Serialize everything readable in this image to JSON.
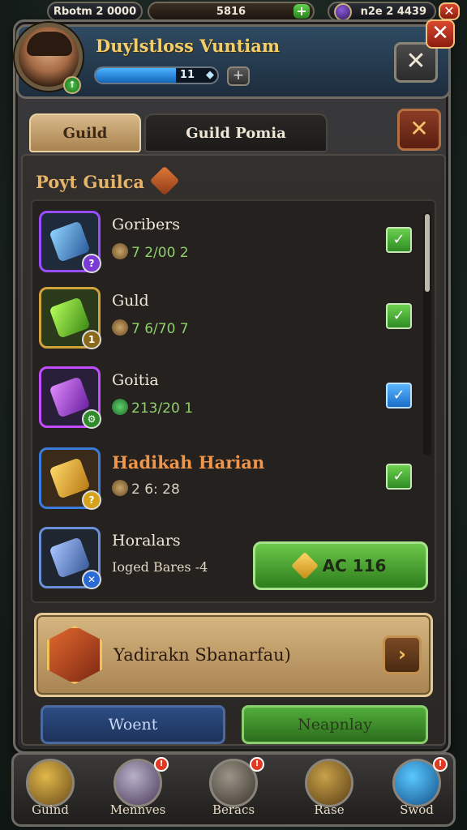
{
  "topbar": {
    "left_currency": "Rbotm 2 0000",
    "mid_currency": "5816",
    "right_currency": "n2e 2 4439"
  },
  "header": {
    "player_name": "Duylstloss Vuntiam",
    "xp_value": "11"
  },
  "tabs": [
    {
      "label": "Guild"
    },
    {
      "label": "Guild Pomia"
    }
  ],
  "section_title": "Poyt Guilca",
  "list": [
    {
      "name": "Goribers",
      "stat": "7 2/00  2",
      "checked": true,
      "check_color": "#4caf3a",
      "accent": "#9a4dff"
    },
    {
      "name": "Guld",
      "stat": "7 6/70  7",
      "checked": true,
      "check_color": "#4caf3a",
      "accent": "#5fd13a"
    },
    {
      "name": "Goitia",
      "stat": "213/20  1",
      "checked": true,
      "check_color": "#3a95e8",
      "accent": "#c14dff"
    },
    {
      "name": "Hadikah Harian",
      "stat": "2 6: 28",
      "checked": true,
      "check_color": "#4caf3a",
      "accent": "#3a7bdc"
    },
    {
      "name": "Horalars",
      "desc": "Ioged Bares -4",
      "accent": "#6b8fd6"
    }
  ],
  "action_button": "AC 116",
  "banner_text": "Yadirakn Sbanarfau)",
  "buttons": {
    "blue": "Woent",
    "green": "Neapnlay"
  },
  "bottom_nav": [
    {
      "label": "Guind"
    },
    {
      "label": "Mennves"
    },
    {
      "label": "Beracs"
    },
    {
      "label": "Rase"
    },
    {
      "label": "Swod"
    }
  ]
}
